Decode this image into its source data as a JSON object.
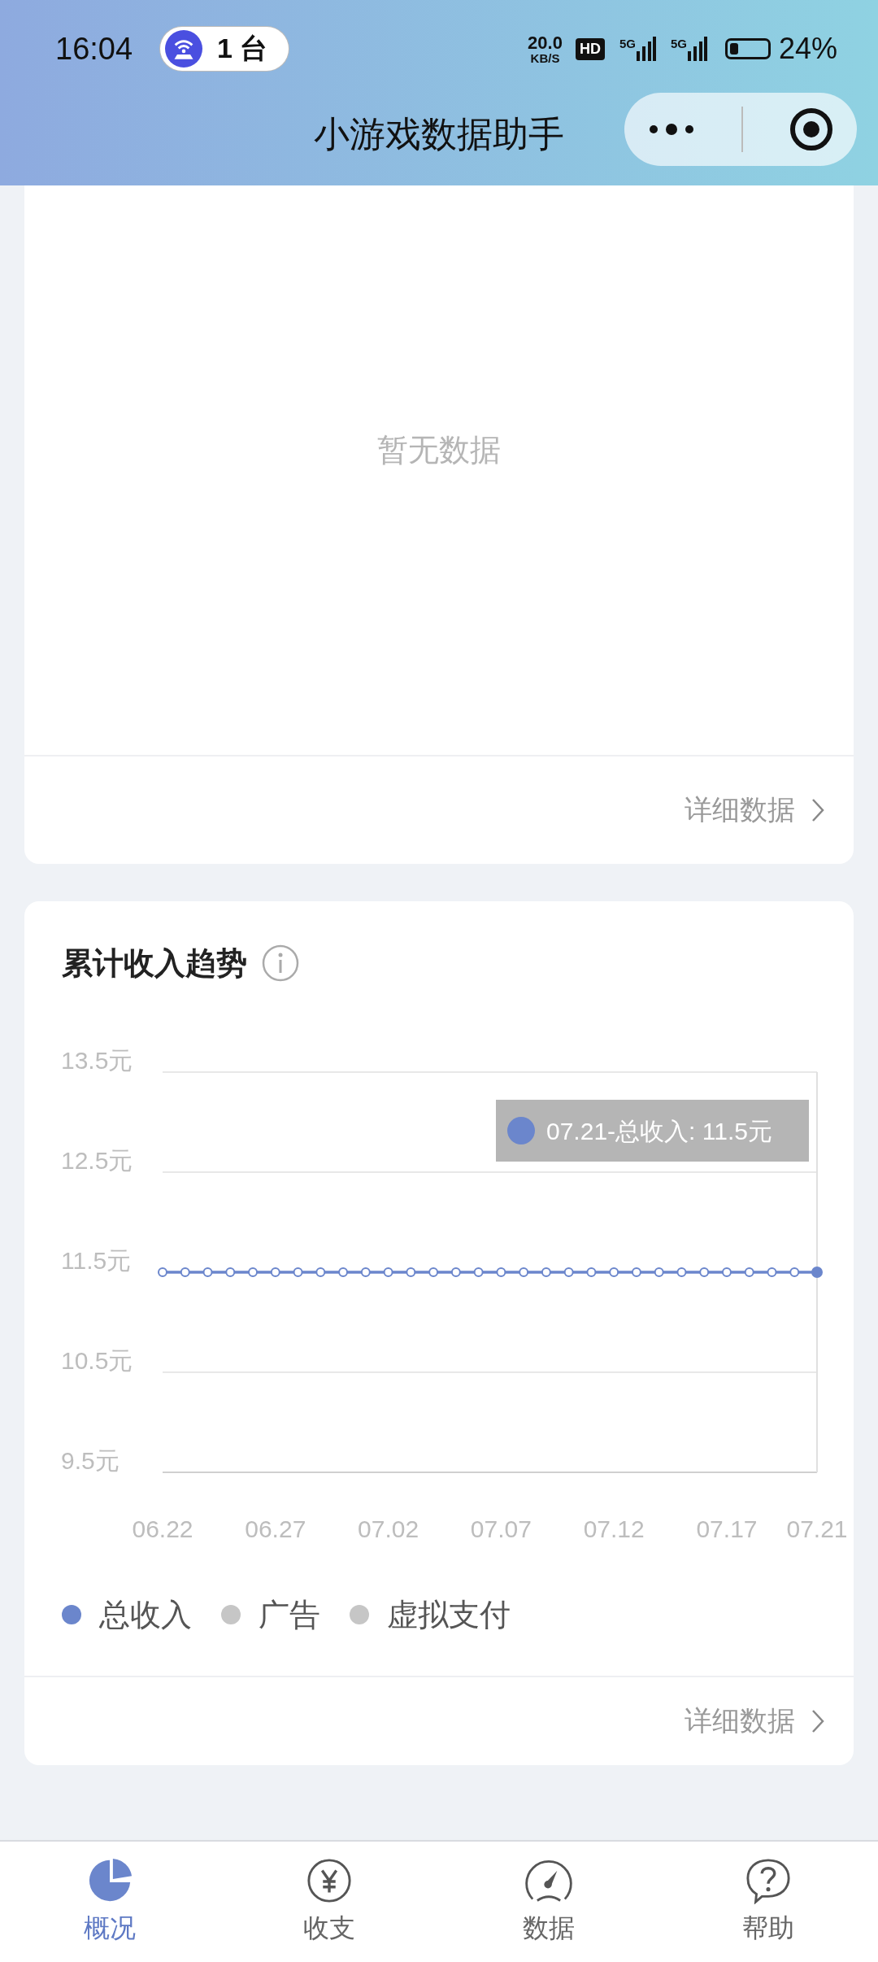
{
  "status_bar": {
    "time": "16:04",
    "device_pill": "1 台",
    "net_speed": "20.0",
    "net_unit": "KB/S",
    "hd_badge": "HD",
    "signals": [
      "5G",
      "5G"
    ],
    "battery": "24%"
  },
  "nav_bar": {
    "title": "小游戏数据助手"
  },
  "cards": [
    {
      "kind": "empty",
      "empty_text": "暂无数据",
      "footer_link": "详细数据"
    },
    {
      "kind": "chart",
      "title": "累计收入趋势",
      "chart_data": {
        "type": "line",
        "categories": [
          "06.22",
          null,
          null,
          null,
          null,
          "06.27",
          null,
          null,
          null,
          null,
          "07.02",
          null,
          null,
          null,
          null,
          "07.07",
          null,
          null,
          null,
          null,
          "07.12",
          null,
          null,
          null,
          null,
          "07.17",
          null,
          null,
          null,
          "07.21"
        ],
        "series": [
          {
            "name": "总收入",
            "color": "#6b86cc",
            "marker": "circle",
            "values": [
              11.5,
              11.5,
              11.5,
              11.5,
              11.5,
              11.5,
              11.5,
              11.5,
              11.5,
              11.5,
              11.5,
              11.5,
              11.5,
              11.5,
              11.5,
              11.5,
              11.5,
              11.5,
              11.5,
              11.5,
              11.5,
              11.5,
              11.5,
              11.5,
              11.5,
              11.5,
              11.5,
              11.5,
              11.5,
              11.5
            ]
          }
        ],
        "ylim": [
          9.5,
          13.5
        ],
        "yticks": [
          {
            "value": 9.5,
            "label": "9.5元"
          },
          {
            "value": 10.5,
            "label": "10.5元"
          },
          {
            "value": 11.5,
            "label": "11.5元"
          },
          {
            "value": 12.5,
            "label": "12.5元"
          },
          {
            "value": 13.5,
            "label": "13.5元"
          }
        ],
        "annotations": [
          "07.21-总收入: 11.5元"
        ]
      },
      "legend": [
        {
          "label": "广告",
          "on": false
        },
        {
          "label": "虚拟支付",
          "on": false
        }
      ],
      "footer_link": "详细数据"
    }
  ],
  "tab_bar": [
    {
      "kind": "pie",
      "label": "概况",
      "selected": true
    },
    {
      "kind": "yen",
      "label": "收支",
      "selected": false
    },
    {
      "kind": "gauge",
      "label": "数据",
      "selected": false
    },
    {
      "kind": "help",
      "label": "帮助",
      "selected": false
    }
  ]
}
